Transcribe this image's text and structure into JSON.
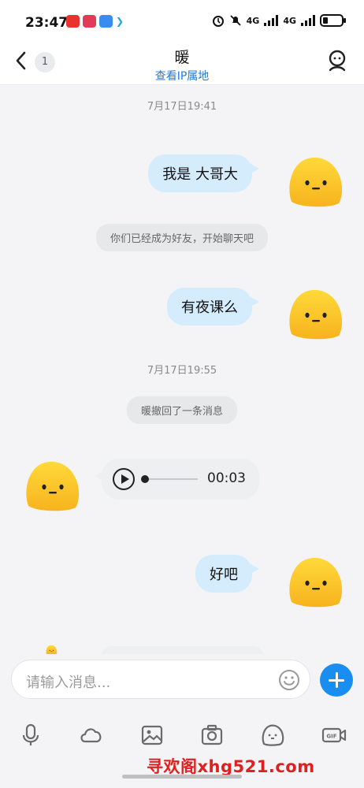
{
  "status_bar": {
    "time": "23:47",
    "signal1": "4G",
    "signal2": "4G"
  },
  "header": {
    "back_badge": "1",
    "title": "暖",
    "subtitle": "查看IP属地"
  },
  "messages": {
    "ts1": "7月17日19:41",
    "msg1": "我是 大哥大",
    "sys1": "你们已经成为好友，开始聊天吧",
    "msg2": "有夜课么",
    "ts2": "7月17日19:55",
    "sys2": "暖撤回了一条消息",
    "voice_duration": "00:03",
    "voice_progress": 0,
    "msg3": "好吧"
  },
  "composer": {
    "placeholder": "请输入消息..."
  },
  "toolbar": {
    "icons": [
      "microphone-icon",
      "cloud-icon",
      "image-icon",
      "camera-icon",
      "sticker-icon",
      "gif-icon"
    ]
  },
  "watermark": "寻欢阁xhg521.com",
  "colors": {
    "outgoing_bubble": "#d5ecfd",
    "incoming_bubble": "#eeeff1",
    "accent": "#1a8df0",
    "link": "#1a7ee0",
    "avatar": "#fbc92a",
    "watermark": "#e02020"
  }
}
